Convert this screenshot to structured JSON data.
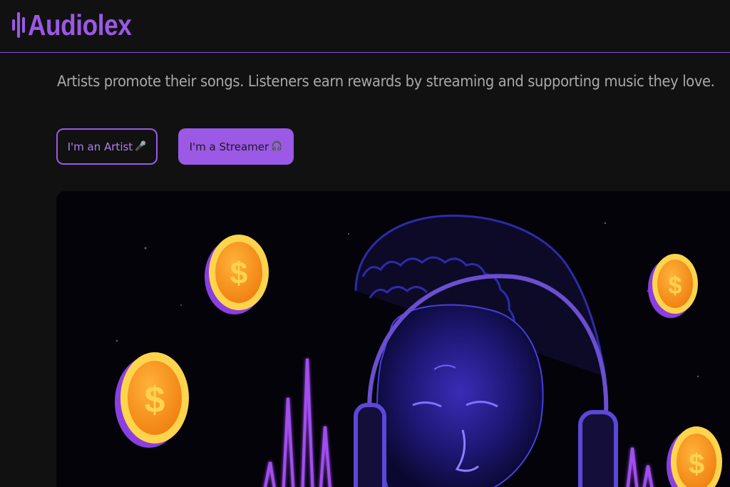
{
  "brand": {
    "name": "Audiolex",
    "accent": "#9b59e6"
  },
  "tagline": "Artists promote their songs. Listeners earn rewards by streaming and supporting music they love.",
  "buttons": {
    "artist_label": "I'm an Artist",
    "artist_icon": "🎤",
    "streamer_label": "I'm a Streamer",
    "streamer_icon": "🎧"
  },
  "hero": {
    "icon_names": [
      "coin-icon",
      "sound-wave-icon",
      "headphones-listener-illustration"
    ]
  }
}
